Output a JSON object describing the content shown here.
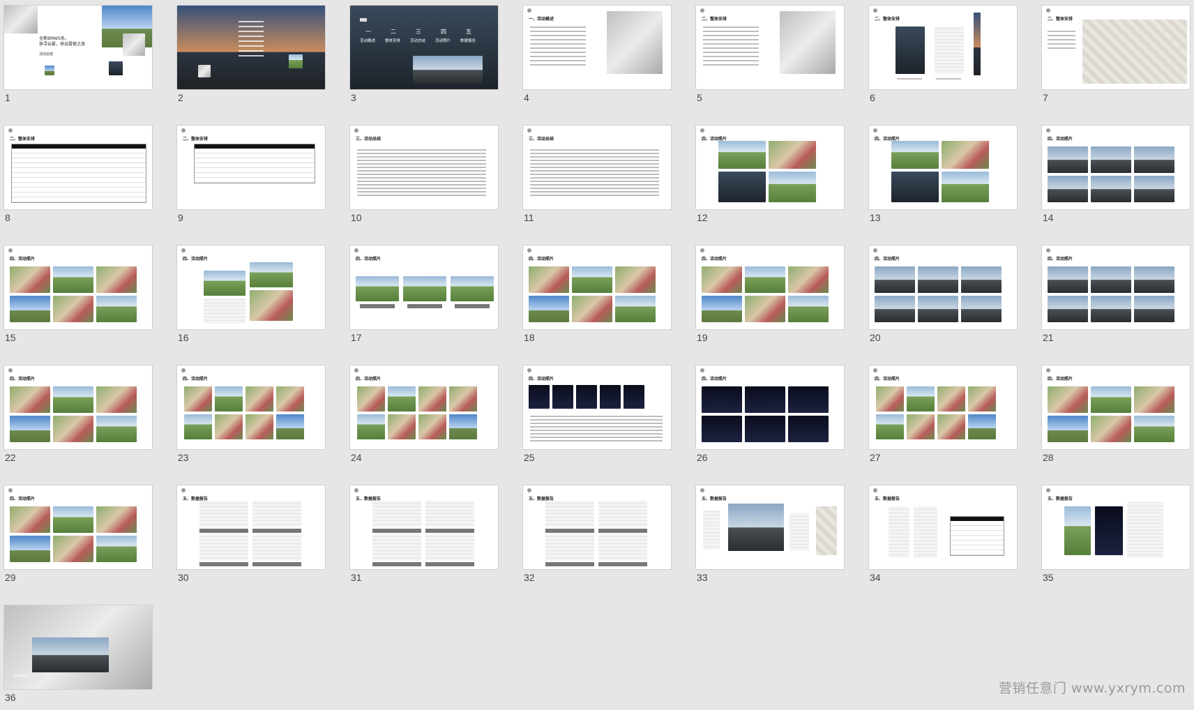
{
  "slides": [
    {
      "n": "1",
      "title": "全新BMW5系，\n探寻云雾，峡谷露营之旅",
      "subtitle": "活动总结"
    },
    {
      "n": "2"
    },
    {
      "n": "3",
      "items": [
        "一",
        "二",
        "三",
        "四",
        "五"
      ],
      "labels": [
        "活动概述",
        "整体安排",
        "活动总结",
        "活动照片",
        "数据报告"
      ]
    },
    {
      "n": "4",
      "header": "一、活动概述"
    },
    {
      "n": "5",
      "header": "二、整体安排"
    },
    {
      "n": "6",
      "header": "二、整体安排"
    },
    {
      "n": "7",
      "header": "二、整体安排"
    },
    {
      "n": "8",
      "header": "二、整体安排"
    },
    {
      "n": "9",
      "header": "二、整体安排"
    },
    {
      "n": "10",
      "header": "三、活动总结"
    },
    {
      "n": "11",
      "header": "三、活动总结"
    },
    {
      "n": "12",
      "header": "四、活动照片"
    },
    {
      "n": "13",
      "header": "四、活动照片"
    },
    {
      "n": "14",
      "header": "四、活动照片"
    },
    {
      "n": "15",
      "header": "四、活动照片"
    },
    {
      "n": "16",
      "header": "四、活动照片"
    },
    {
      "n": "17",
      "header": "四、活动照片"
    },
    {
      "n": "18",
      "header": "四、活动照片"
    },
    {
      "n": "19",
      "header": "四、活动照片"
    },
    {
      "n": "20",
      "header": "四、活动照片"
    },
    {
      "n": "21",
      "header": "四、活动照片"
    },
    {
      "n": "22",
      "header": "四、活动照片"
    },
    {
      "n": "23",
      "header": "四、活动照片"
    },
    {
      "n": "24",
      "header": "四、活动照片"
    },
    {
      "n": "25",
      "header": "四、活动照片"
    },
    {
      "n": "26",
      "header": "四、活动照片"
    },
    {
      "n": "27",
      "header": "四、活动照片"
    },
    {
      "n": "28",
      "header": "四、活动照片"
    },
    {
      "n": "29",
      "header": "四、活动照片"
    },
    {
      "n": "30",
      "header": "五、数据报告"
    },
    {
      "n": "31",
      "header": "五、数据报告"
    },
    {
      "n": "32",
      "header": "五、数据报告"
    },
    {
      "n": "33",
      "header": "五、数据报告"
    },
    {
      "n": "34",
      "header": "五、数据报告"
    },
    {
      "n": "35",
      "header": "五、数据报告"
    },
    {
      "n": "36",
      "closing": "THANKS"
    }
  ],
  "watermark": "营销任意门 www.yxrym.com",
  "colors": {
    "background": "#e6e6e6",
    "accent": "#2f78c4",
    "thumb": "#ffffff"
  }
}
